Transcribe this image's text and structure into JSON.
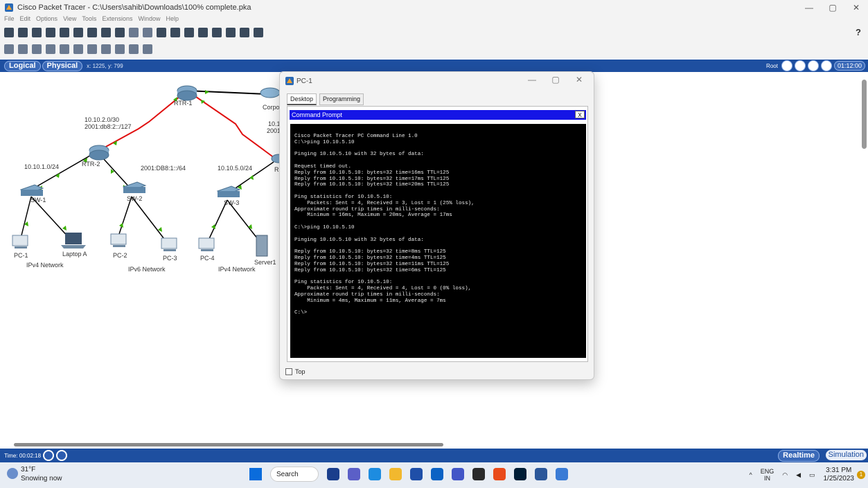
{
  "window": {
    "title": "Cisco Packet Tracer - C:\\Users\\sahib\\Downloads\\100% complete.pka",
    "controls": [
      "—",
      "▢",
      "✕"
    ]
  },
  "menu": [
    "File",
    "Edit",
    "Options",
    "View",
    "Tools",
    "Extensions",
    "Window",
    "Help"
  ],
  "workspace": {
    "logical_tab": "Logical",
    "physical_tab": "Physical",
    "coords": "x: 1225, y: 799",
    "root_label": "Root",
    "clock": "01:12:00"
  },
  "topology": {
    "labels": {
      "rtr1": "RTR-1",
      "rtr2": "RTR-2",
      "rtr3": "R",
      "corp": "Corpor",
      "net_10_10_2": "10.10.2.0/30",
      "net_v6_2": "2001:db8:2::/127",
      "net_10_1": "10.1",
      "net_2001": "2001",
      "net_10_10_1": "10.10.1.0/24",
      "net_v6_1": "2001:DB8:1::/64",
      "net_10_10_5": "10.10.5.0/24",
      "sw1": "SW-1",
      "sw2": "SW-2",
      "sw3": "SW-3",
      "pc1": "PC-1",
      "laptop": "Laptop A",
      "pc2": "PC-2",
      "pc3": "PC-3",
      "pc4": "PC-4",
      "server": "Server1",
      "ipv4_net1": "IPv4 Network",
      "ipv6_net": "IPv6 Network",
      "ipv4_net2": "IPv4 Network"
    }
  },
  "dialog": {
    "title": "PC-1",
    "tabs": [
      "Desktop",
      "Programming"
    ],
    "cmd_title": "Command Prompt",
    "close_btn": "X",
    "terminal": "Cisco Packet Tracer PC Command Line 1.0\nC:\\>ping 10.10.5.10\n\nPinging 10.10.5.10 with 32 bytes of data:\n\nRequest timed out.\nReply from 10.10.5.10: bytes=32 time=16ms TTL=125\nReply from 10.10.5.10: bytes=32 time=17ms TTL=125\nReply from 10.10.5.10: bytes=32 time=20ms TTL=125\n\nPing statistics for 10.10.5.10:\n    Packets: Sent = 4, Received = 3, Lost = 1 (25% loss),\nApproximate round trip times in milli-seconds:\n    Minimum = 16ms, Maximum = 20ms, Average = 17ms\n\nC:\\>ping 10.10.5.10\n\nPinging 10.10.5.10 with 32 bytes of data:\n\nReply from 10.10.5.10: bytes=32 time=8ms TTL=125\nReply from 10.10.5.10: bytes=32 time=4ms TTL=125\nReply from 10.10.5.10: bytes=32 time=11ms TTL=125\nReply from 10.10.5.10: bytes=32 time=6ms TTL=125\n\nPing statistics for 10.10.5.10:\n    Packets: Sent = 4, Received = 4, Lost = 0 (0% loss),\nApproximate round trip times in milli-seconds:\n    Minimum = 4ms, Maximum = 11ms, Average = 7ms\n\nC:\\>",
    "top_checkbox": "Top"
  },
  "status": {
    "time": "Time: 00:02:18",
    "realtime": "Realtime",
    "simulation": "Simulation"
  },
  "taskbar": {
    "temp": "31°F",
    "weather": "Snowing now",
    "search": "Search",
    "lang1": "ENG",
    "lang2": "IN",
    "time": "3:31 PM",
    "date": "1/25/2023",
    "notif_count": "1"
  }
}
